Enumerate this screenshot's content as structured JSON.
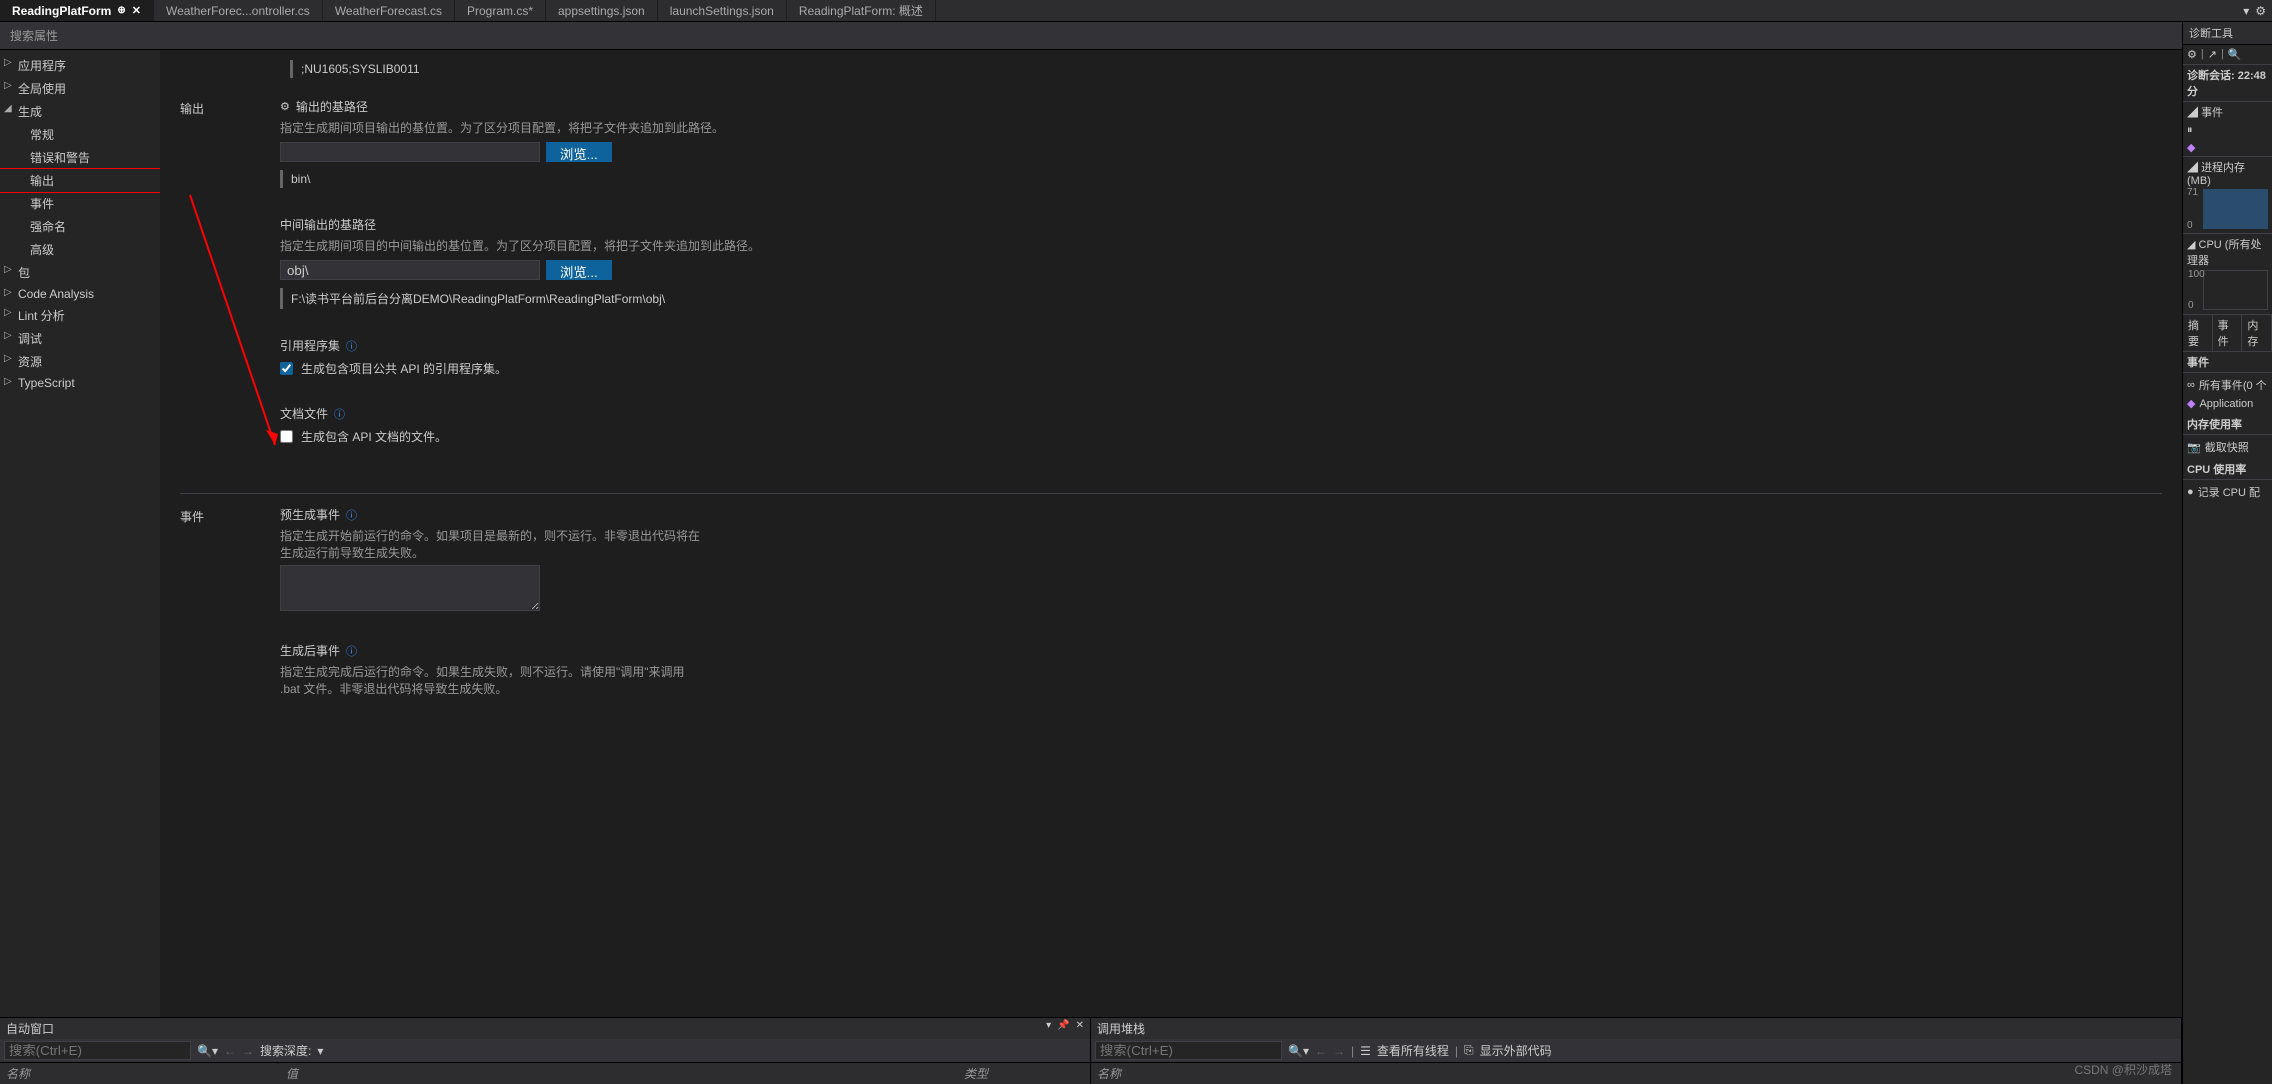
{
  "tabs": [
    {
      "label": "ReadingPlatForm",
      "active": true,
      "pinned": true,
      "close": true
    },
    {
      "label": "WeatherForec...ontroller.cs"
    },
    {
      "label": "WeatherForecast.cs"
    },
    {
      "label": "Program.cs*"
    },
    {
      "label": "appsettings.json"
    },
    {
      "label": "launchSettings.json"
    },
    {
      "label": "ReadingPlatForm: 概述"
    }
  ],
  "prop_search_placeholder": "搜索属性",
  "tree": {
    "app": "应用程序",
    "global": "全局使用",
    "build": "生成",
    "build_children": [
      "常规",
      "错误和警告",
      "输出",
      "事件",
      "强命名",
      "高级"
    ],
    "package": "包",
    "code_analysis": "Code Analysis",
    "lint": "Lint 分析",
    "debug": "调试",
    "resource": "资源",
    "typescript": "TypeScript"
  },
  "warn_codes": ";NU1605;SYSLIB0011",
  "output_section": "输出",
  "output_base": {
    "title": "输出的基路径",
    "desc": "指定生成期间项目输出的基位置。为了区分项目配置，将把子文件夹追加到此路径。",
    "browse": "浏览...",
    "path": "bin\\"
  },
  "inter_base": {
    "title": "中间输出的基路径",
    "desc": "指定生成期间项目的中间输出的基位置。为了区分项目配置，将把子文件夹追加到此路径。",
    "value": "obj\\",
    "browse": "浏览...",
    "path": "F:\\读书平台前后台分离DEMO\\ReadingPlatForm\\ReadingPlatForm\\obj\\"
  },
  "ref_asm": {
    "title": "引用程序集",
    "desc": "生成包含项目公共 API 的引用程序集。"
  },
  "doc_file": {
    "title": "文档文件",
    "desc": "生成包含 API 文档的文件。"
  },
  "events_section": "事件",
  "pre_build": {
    "title": "预生成事件",
    "desc": "指定生成开始前运行的命令。如果项目是最新的，则不运行。非零退出代码将在生成运行前导致生成失败。"
  },
  "post_build": {
    "title": "生成后事件",
    "desc": "指定生成完成后运行的命令。如果生成失败，则不运行。请使用\"调用\"来调用 .bat 文件。非零退出代码将导致生成失败。"
  },
  "diag": {
    "title": "诊断工具",
    "session": "诊断会话: 22:48 分",
    "events": "事件",
    "mem_header": "进程内存 (MB)",
    "mem_max": "71",
    "mem_min": "0",
    "cpu_header": "CPU (所有处理器",
    "cpu_max": "100",
    "cpu_min": "0",
    "tabs": [
      "摘要",
      "事件",
      "内存"
    ],
    "events2": "事件",
    "all_events": "所有事件(0 个",
    "app_insights": "Application",
    "mem_usage": "内存使用率",
    "snapshot": "截取快照",
    "cpu_usage": "CPU 使用率",
    "record_cpu": "记录 CPU 配"
  },
  "bottom": {
    "auto_window": "自动窗口",
    "search_placeholder": "搜索(Ctrl+E)",
    "search_depth": "搜索深度:",
    "col_name": "名称",
    "col_value": "值",
    "col_type": "类型",
    "call_stack": "调用堆栈",
    "view_threads": "查看所有线程",
    "show_external": "显示外部代码",
    "col_name2": "名称"
  },
  "watermark": "CSDN @积沙成塔"
}
